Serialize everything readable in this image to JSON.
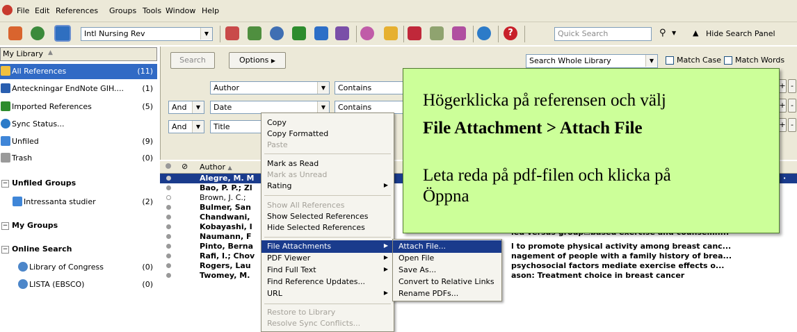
{
  "menubar": {
    "items": [
      "File",
      "Edit",
      "References",
      "Groups",
      "Tools",
      "Window",
      "Help"
    ]
  },
  "toolbar": {
    "style_value": "Intl Nursing Rev",
    "quick_search_placeholder": "Quick Search",
    "hide_search_panel": "Hide Search Panel"
  },
  "sidebar": {
    "header": "My Library",
    "items": [
      {
        "label": "All References",
        "count": "(11)"
      },
      {
        "label": "Anteckningar EndNote GIH....",
        "count": "(1)"
      },
      {
        "label": "Imported References",
        "count": "(5)"
      },
      {
        "label": "Sync Status...",
        "count": ""
      },
      {
        "label": "Unfiled",
        "count": "(9)"
      },
      {
        "label": "Trash",
        "count": "(0)"
      }
    ],
    "unfiled_groups": {
      "title": "Unfiled Groups",
      "items": [
        {
          "label": "Intressanta studier",
          "count": "(2)"
        }
      ]
    },
    "my_groups": {
      "title": "My Groups"
    },
    "online_search": {
      "title": "Online Search",
      "items": [
        {
          "label": "Library of Congress",
          "count": "(0)"
        },
        {
          "label": "LISTA (EBSCO)",
          "count": "(0)"
        }
      ]
    }
  },
  "search": {
    "search_button": "Search",
    "options_button": "Options",
    "scope": "Search Whole Library",
    "match_case": "Match Case",
    "match_words": "Match Words",
    "rows": [
      {
        "bool": "",
        "field": "Author",
        "op": "Contains"
      },
      {
        "bool": "And",
        "field": "Date",
        "op": "Contains"
      },
      {
        "bool": "And",
        "field": "Title",
        "op": ""
      }
    ]
  },
  "list": {
    "author_header": "Author",
    "rows": [
      {
        "author": "Alegre, M. M",
        "title": ""
      },
      {
        "author": "Bao, P. P.; Zl",
        "title": ""
      },
      {
        "author": "Brown, J. C.;",
        "title": ""
      },
      {
        "author": "Bulmer, San",
        "title": ""
      },
      {
        "author": "Chandwani,",
        "title": ""
      },
      {
        "author": "Kobayashi, I",
        "title": ""
      },
      {
        "author": "Naumann, F",
        "title": "ied versus group☐based exercise and counsellin..."
      },
      {
        "author": "Pinto, Berna",
        "title": "l to promote physical activity among breast canc..."
      },
      {
        "author": "Rafi, I.; Chov",
        "title": "nagement of people with a family history of brea..."
      },
      {
        "author": "Rogers, Lau",
        "title": "psychosocial factors mediate exercise effects o..."
      },
      {
        "author": "Twomey, M.",
        "title": "ason: Treatment choice in breast cancer"
      }
    ]
  },
  "context_menu": {
    "items": [
      "Copy",
      "Copy Formatted",
      "Paste",
      "Mark as Read",
      "Mark as Unread",
      "Rating",
      "Show All References",
      "Show Selected References",
      "Hide Selected References",
      "File Attachments",
      "PDF Viewer",
      "Find Full Text",
      "Find Reference Updates...",
      "URL",
      "Restore to Library",
      "Resolve Sync Conflicts..."
    ]
  },
  "submenu": {
    "items": [
      "Attach File...",
      "Open File",
      "Save As...",
      "Convert to Relative Links",
      "Rename PDFs..."
    ]
  },
  "callout": {
    "line1": "Högerklicka på referensen och välj",
    "line2": "File Attachment > Attach File",
    "line3": "Leta reda på pdf-filen och klicka på",
    "line4": "Öppna"
  },
  "colors": {
    "selection": "#1a3b8c",
    "callout_bg": "#ccff99",
    "chrome": "#ece9d8"
  }
}
